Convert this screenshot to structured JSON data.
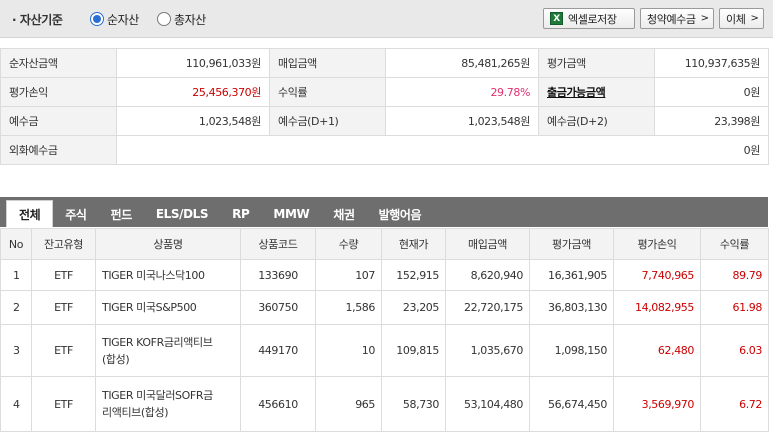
{
  "header": {
    "title": "· 자산기준",
    "radio_options": [
      {
        "label": "순자산",
        "checked": true
      },
      {
        "label": "총자산",
        "checked": false
      }
    ],
    "excel_button": "엑셀로저장",
    "subscription_button": "청약예수금",
    "transfer_button": "이체"
  },
  "summary": {
    "net_asset_label": "순자산금액",
    "net_asset": "110,961,033원",
    "purchase_label": "매입금액",
    "purchase": "85,481,265원",
    "eval_label": "평가금액",
    "eval": "110,937,635원",
    "pnl_label": "평가손익",
    "pnl": "25,456,370원",
    "return_label": "수익률",
    "return": "29.78%",
    "withdrawable_label": "출금가능금액",
    "withdrawable": "0원",
    "deposit_label": "예수금",
    "deposit": "1,023,548원",
    "deposit_d1_label": "예수금(D+1)",
    "deposit_d1": "1,023,548원",
    "deposit_d2_label": "예수금(D+2)",
    "deposit_d2": "23,398원",
    "fx_deposit_label": "외화예수금",
    "fx_deposit": "0원"
  },
  "tabs": [
    "전체",
    "주식",
    "펀드",
    "ELS/DLS",
    "RP",
    "MMW",
    "채권",
    "발행어음"
  ],
  "holdings": {
    "columns": [
      "No",
      "잔고유형",
      "상품명",
      "상품코드",
      "수량",
      "현재가",
      "매입금액",
      "평가금액",
      "평가손익",
      "수익률"
    ],
    "rows": [
      {
        "no": "1",
        "type": "ETF",
        "name": "TIGER 미국나스닥100",
        "code": "133690",
        "qty": "107",
        "price": "152,915",
        "purchase": "8,620,940",
        "eval": "16,361,905",
        "pnl": "7,740,965",
        "ret": "89.79"
      },
      {
        "no": "2",
        "type": "ETF",
        "name": "TIGER 미국S&P500",
        "code": "360750",
        "qty": "1,586",
        "price": "23,205",
        "purchase": "22,720,175",
        "eval": "36,803,130",
        "pnl": "14,082,955",
        "ret": "61.98"
      },
      {
        "no": "3",
        "type": "ETF",
        "name": "TIGER KOFR금리액티브\n(합성)",
        "code": "449170",
        "qty": "10",
        "price": "109,815",
        "purchase": "1,035,670",
        "eval": "1,098,150",
        "pnl": "62,480",
        "ret": "6.03"
      },
      {
        "no": "4",
        "type": "ETF",
        "name": "TIGER 미국달러SOFR금\n리액티브(합성)",
        "code": "456610",
        "qty": "965",
        "price": "58,730",
        "purchase": "53,104,480",
        "eval": "56,674,450",
        "pnl": "3,569,970",
        "ret": "6.72"
      }
    ]
  }
}
